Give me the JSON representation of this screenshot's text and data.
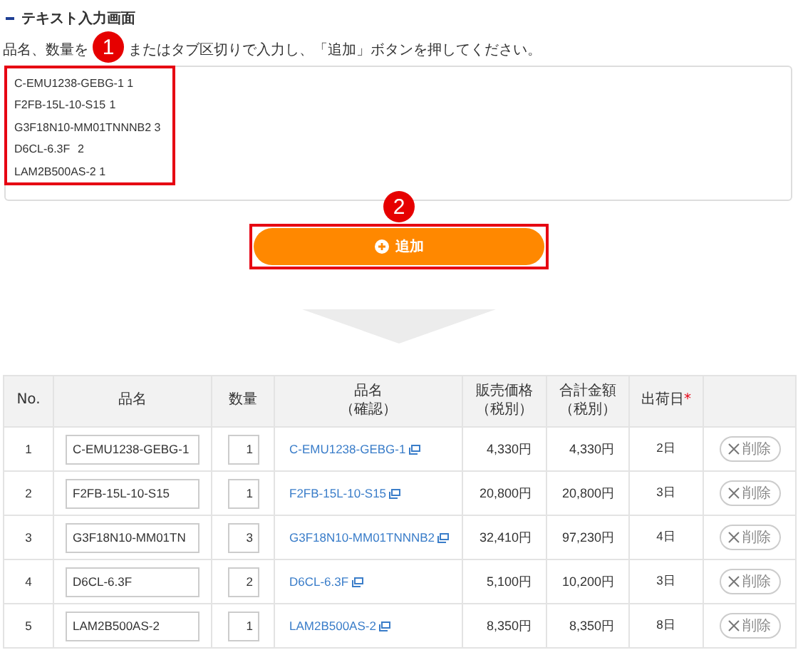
{
  "section_title": "テキスト入力画面",
  "instruction": {
    "before": "品名、数量を",
    "after": "またはタブ区切りで入力し、「追加」ボタンを押してください。"
  },
  "annotations": [
    "1",
    "2"
  ],
  "text_input": {
    "lines": [
      "C-EMU1238-GEBG-1 1",
      "F2FB-15L-10-S15\t1",
      "G3F18N10-MM01TNNNB2 3",
      "D6CL-6.3F\t2",
      "LAM2B500AS-2 1"
    ]
  },
  "add_button": {
    "label": "追加"
  },
  "table": {
    "columns": [
      {
        "lines": [
          "No."
        ]
      },
      {
        "lines": [
          "品名"
        ]
      },
      {
        "lines": [
          "数量"
        ]
      },
      {
        "lines": [
          "品名",
          "（確認）"
        ]
      },
      {
        "lines": [
          "販売価格",
          "（税別）"
        ]
      },
      {
        "lines": [
          "合計金額",
          "（税別）"
        ]
      },
      {
        "lines": [
          "出荷日"
        ],
        "required_mark": "*"
      },
      {}
    ],
    "rows": [
      {
        "no": "1",
        "name": "C-EMU1238-GEBG-1",
        "qty": "1",
        "link": "C-EMU1238-GEBG-1",
        "price": "4,330円",
        "total": "4,330円",
        "ship": "2日",
        "delete": "削除"
      },
      {
        "no": "2",
        "name": "F2FB-15L-10-S15",
        "qty": "1",
        "link": "F2FB-15L-10-S15",
        "price": "20,800円",
        "total": "20,800円",
        "ship": "3日",
        "delete": "削除"
      },
      {
        "no": "3",
        "name": "G3F18N10-MM01TN",
        "qty": "3",
        "link": "G3F18N10-MM01TNNNB2",
        "price": "32,410円",
        "total": "97,230円",
        "ship": "4日",
        "delete": "削除"
      },
      {
        "no": "4",
        "name": "D6CL-6.3F",
        "qty": "2",
        "link": "D6CL-6.3F",
        "price": "5,100円",
        "total": "10,200円",
        "ship": "3日",
        "delete": "削除"
      },
      {
        "no": "5",
        "name": "LAM2B500AS-2",
        "qty": "1",
        "link": "LAM2B500AS-2",
        "price": "8,350円",
        "total": "8,350円",
        "ship": "8日",
        "delete": "削除"
      }
    ]
  }
}
